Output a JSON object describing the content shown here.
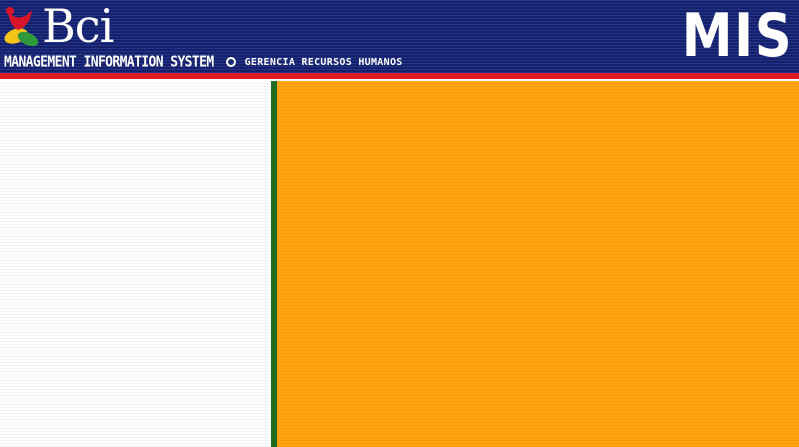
{
  "header": {
    "logo_text": "Bci",
    "system_name": "Management Information System",
    "department": "Gerencia Recursos Humanos",
    "app_badge": "MIS"
  },
  "colors": {
    "header_bg": "#1b2a78",
    "header_stripe": "#e11b22",
    "divider": "#1f6b1f",
    "content_bg": "#ffa412",
    "sidebar_bg": "#ffffff"
  },
  "icons": {
    "logo_mark": "bci-tricolor-mark-icon",
    "separator": "ring-bullet-icon"
  }
}
